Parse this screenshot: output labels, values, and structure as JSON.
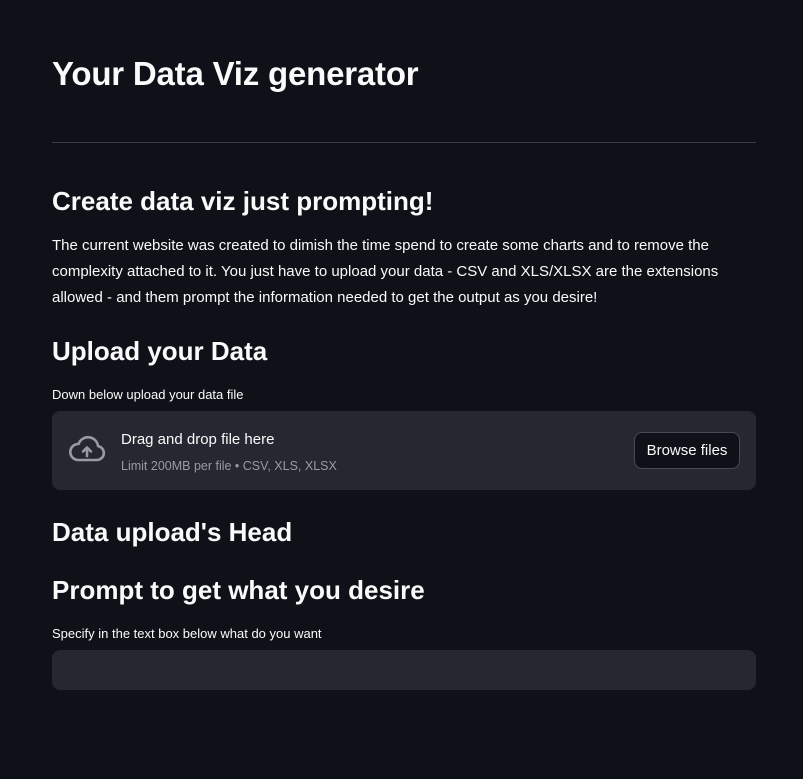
{
  "header": {
    "title": "Your Data Viz generator"
  },
  "intro": {
    "heading": "Create data viz just prompting!",
    "text": "The current website was created to dimish the time spend to create some charts and to remove the complexity attached to it. You just have to upload your data - CSV and XLS/XLSX are the extensions allowed - and them prompt the information needed to get the output as you desire!"
  },
  "upload": {
    "heading": "Upload your Data",
    "caption": "Down below upload your data file",
    "dropzone_title": "Drag and drop file here",
    "dropzone_limit": "Limit 200MB per file • CSV, XLS, XLSX",
    "browse_label": "Browse files",
    "icon": "cloud-upload-icon"
  },
  "head": {
    "heading": "Data upload's Head"
  },
  "prompt": {
    "heading": "Prompt to get what you desire",
    "caption": "Specify in the text box below what do you want",
    "value": "",
    "placeholder": ""
  },
  "colors": {
    "background": "#0e1117",
    "surface": "#262730",
    "text": "#fafafa",
    "muted_text": "#9a9ba1",
    "divider": "#3a3d46"
  }
}
